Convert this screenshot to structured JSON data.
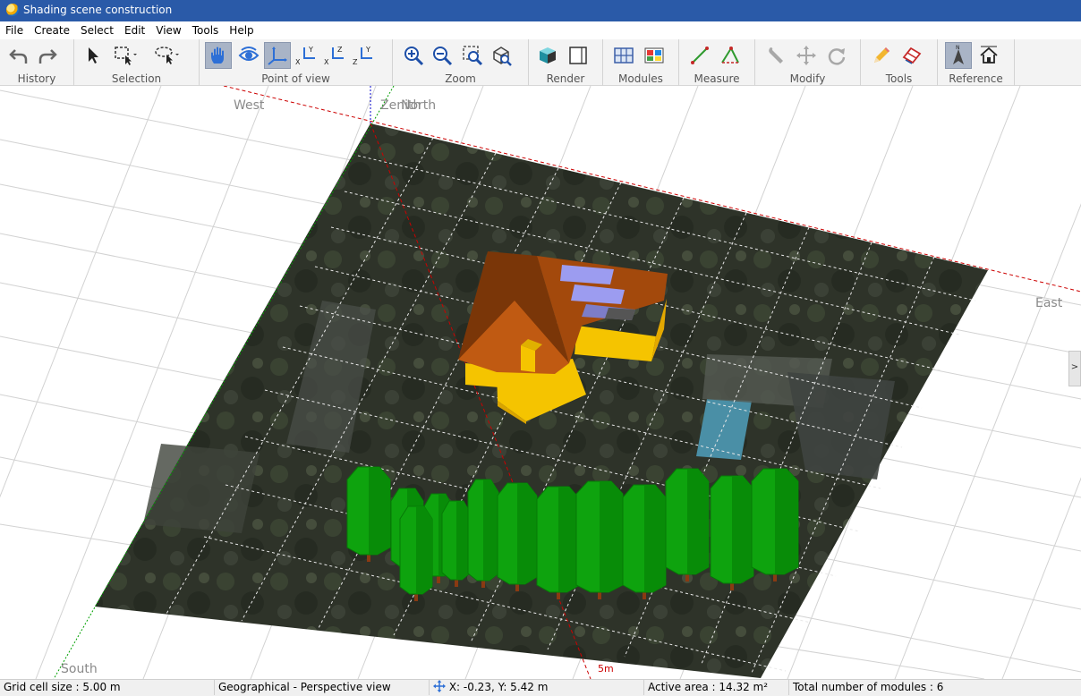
{
  "window": {
    "title": "Shading scene construction"
  },
  "menu": [
    "File",
    "Create",
    "Select",
    "Edit",
    "View",
    "Tools",
    "Help"
  ],
  "toolbar": {
    "groups": {
      "history": "History",
      "selection": "Selection",
      "point_of_view": "Point of view",
      "zoom": "Zoom",
      "render": "Render",
      "modules": "Modules",
      "measure": "Measure",
      "modify": "Modify",
      "tools": "Tools",
      "reference": "Reference"
    },
    "icons": {
      "history": [
        "undo-icon",
        "redo-icon"
      ],
      "selection": [
        "pointer-icon",
        "rectangle-select-icon",
        "lasso-select-icon"
      ],
      "point_of_view": [
        "pan-hand-icon",
        "orbit-eye-icon",
        "axes-icon",
        "xy-view-icon",
        "xz-view-icon",
        "zy-view-icon"
      ],
      "zoom": [
        "zoom-in-icon",
        "zoom-out-icon",
        "zoom-window-icon",
        "zoom-fit-icon"
      ],
      "render": [
        "solid-render-icon",
        "wire-render-icon"
      ],
      "modules": [
        "module-grid-icon",
        "module-color-icon"
      ],
      "measure": [
        "measure-distance-icon",
        "measure-angle-icon"
      ],
      "modify": [
        "wrench-icon",
        "move-icon",
        "rotate-icon"
      ],
      "tools": [
        "pencil-icon",
        "eraser-icon"
      ],
      "reference": [
        "north-arrow-icon",
        "house-reference-icon"
      ]
    }
  },
  "viewport": {
    "labels": {
      "west": "West",
      "zenith": "Zenith",
      "north": "North",
      "east": "East",
      "south": "South",
      "scale": "5m"
    },
    "colors": {
      "roof": "#a3490c",
      "walls": "#f5c400",
      "panels": "#9c9cf0",
      "trees": "#0ea30e",
      "axis_red": "#cc0000",
      "axis_green": "#00a000",
      "axis_blue": "#0000cc"
    },
    "side_handle": ">"
  },
  "status": {
    "grid_cell": "Grid cell size :  5.00 m",
    "view": "Geographical - Perspective view",
    "cursor": "X: -0.23, Y: 5.42 m",
    "active_area": "Active area : 14.32 m²",
    "total_modules": "Total number of modules : 6"
  }
}
